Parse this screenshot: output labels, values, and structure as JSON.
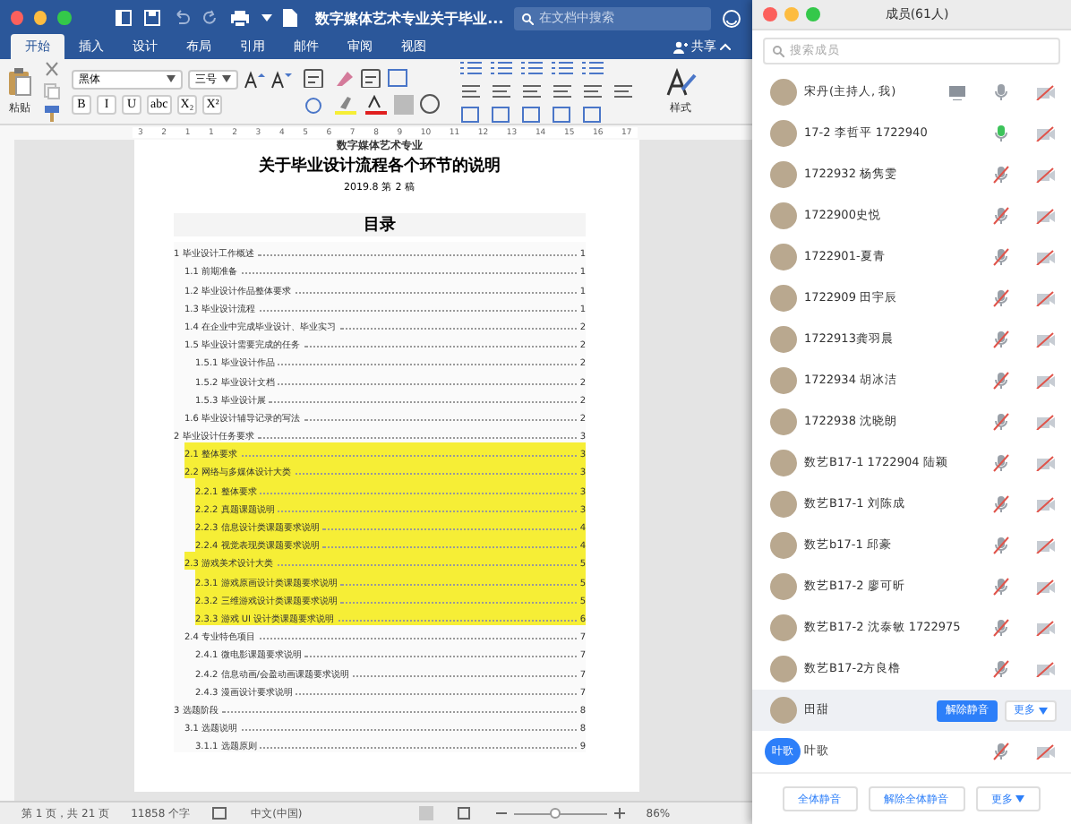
{
  "word": {
    "title": "数字媒体艺术专业关于毕业...",
    "search": {
      "placeholder": "在文档中搜索"
    },
    "tabs": [
      {
        "label": "开始",
        "selected": true
      },
      {
        "label": "插入",
        "selected": false
      },
      {
        "label": "设计",
        "selected": false
      },
      {
        "label": "布局",
        "selected": false
      },
      {
        "label": "引用",
        "selected": false
      },
      {
        "label": "邮件",
        "selected": false
      },
      {
        "label": "审阅",
        "selected": false
      },
      {
        "label": "视图",
        "selected": false
      }
    ],
    "share": "共享",
    "ribbon": {
      "paste": "粘贴",
      "font": "黑体",
      "size": "三号",
      "format_buttons": [
        "B",
        "I",
        "U",
        "abc",
        "X₂",
        "X²"
      ],
      "styles": "样式"
    },
    "ruler": [
      "3",
      "2",
      "1",
      "1",
      "2",
      "3",
      "4",
      "5",
      "6",
      "7",
      "8",
      "9",
      "10",
      "11",
      "12",
      "13",
      "14",
      "15",
      "16",
      "17"
    ],
    "document": {
      "header_cut": "数字媒体艺术专业",
      "title": "关于毕业设计流程各个环节的说明",
      "subtitle": "2019.8  第 2 稿",
      "toc_title": "目录",
      "toc": [
        {
          "text": "1 毕业设计工作概述",
          "page": "1",
          "highlighted": false,
          "children": [
            {
              "text": "1.1 前期准备",
              "page": "1",
              "highlighted": false
            },
            {
              "text": "1.2 毕业设计作品整体要求",
              "page": "1",
              "highlighted": false
            },
            {
              "text": "1.3 毕业设计流程",
              "page": "1",
              "highlighted": false
            },
            {
              "text": "1.4 在企业中完成毕业设计、毕业实习",
              "page": "2",
              "highlighted": false
            },
            {
              "text": "1.5  毕业设计需要完成的任务",
              "page": "2",
              "highlighted": false,
              "children": [
                {
                  "text": "1.5.1 毕业设计作品",
                  "page": "2",
                  "highlighted": false
                },
                {
                  "text": "1.5.2 毕业设计文档",
                  "page": "2",
                  "highlighted": false
                },
                {
                  "text": "1.5.3 毕业设计展",
                  "page": "2",
                  "highlighted": false
                }
              ]
            },
            {
              "text": "1.6  毕业设计辅导记录的写法",
              "page": "2",
              "highlighted": false
            }
          ]
        },
        {
          "text": "2  毕业设计任务要求",
          "page": "3",
          "highlighted": false,
          "children": [
            {
              "text": "2.1 整体要求",
              "page": "3",
              "highlighted": true
            },
            {
              "text": "2.2  网络与多媒体设计大类",
              "page": "3",
              "highlighted": true,
              "children": [
                {
                  "text": "2.2.1 整体要求",
                  "page": "3",
                  "highlighted": true
                },
                {
                  "text": "2.2.2 真题课题说明",
                  "page": "3",
                  "highlighted": true
                },
                {
                  "text": "2.2.3 信息设计类课题要求说明",
                  "page": "4",
                  "highlighted": true
                },
                {
                  "text": "2.2.4 视觉表现类课题要求说明",
                  "page": "4",
                  "highlighted": true
                }
              ]
            },
            {
              "text": "2.3  游戏美术设计大类",
              "page": "5",
              "highlighted": true,
              "children": [
                {
                  "text": "2.3.1  游戏原画设计类课题要求说明",
                  "page": "5",
                  "highlighted": true
                },
                {
                  "text": "2.3.2  三维游戏设计类课题要求说明",
                  "page": "5",
                  "highlighted": true
                },
                {
                  "text": "2.3.3  游戏 UI 设计类课题要求说明",
                  "page": "6",
                  "highlighted": true
                }
              ]
            },
            {
              "text": "2.4  专业特色项目",
              "page": "7",
              "highlighted": false,
              "children": [
                {
                  "text": "2.4.1  微电影课题要求说明",
                  "page": "7",
                  "highlighted": false
                },
                {
                  "text": "2.4.2  信息动画/会盈动画课题要求说明",
                  "page": "7",
                  "highlighted": false
                },
                {
                  "text": "2.4.3  漫画设计要求说明",
                  "page": "7",
                  "highlighted": false
                }
              ]
            }
          ]
        },
        {
          "text": "3 选题阶段",
          "page": "8",
          "highlighted": false,
          "children": [
            {
              "text": "3.1 选题说明",
              "page": "8",
              "highlighted": false,
              "children": [
                {
                  "text": "3.1.1  选题原则",
                  "page": "9",
                  "highlighted": false
                }
              ]
            }
          ]
        }
      ]
    },
    "status_bar": {
      "page": "第 1 页，共 21 页",
      "words": "11858 个字",
      "language": "中文(中国)",
      "zoom_slider": {
        "level": 0.45
      },
      "zoom": "86%"
    }
  },
  "members_panel": {
    "title": "成员(61人)",
    "search": {
      "placeholder": "搜索成员"
    },
    "members": [
      {
        "name": "宋丹(主持人, 我)",
        "muted": false,
        "speaking": false,
        "sharing": true
      },
      {
        "name": "17-2 李哲平 1722940",
        "muted": false,
        "speaking": true,
        "sharing": false
      },
      {
        "name": "1722932 杨隽雯",
        "muted": true,
        "speaking": false,
        "sharing": false
      },
      {
        "name": "1722900史悦",
        "muted": true,
        "speaking": false,
        "sharing": false
      },
      {
        "name": "1722901-夏青",
        "muted": true,
        "speaking": false,
        "sharing": false
      },
      {
        "name": "1722909 田宇辰",
        "muted": true,
        "speaking": false,
        "sharing": false
      },
      {
        "name": "1722913龚羽晨",
        "muted": true,
        "speaking": false,
        "sharing": false
      },
      {
        "name": "1722934 胡冰洁",
        "muted": true,
        "speaking": false,
        "sharing": false
      },
      {
        "name": "1722938 沈晓朗",
        "muted": true,
        "speaking": false,
        "sharing": false
      },
      {
        "name": "数艺B17-1 1722904 陆颖",
        "muted": true,
        "speaking": false,
        "sharing": false
      },
      {
        "name": "数艺B17-1 刘陈成",
        "muted": true,
        "speaking": false,
        "sharing": false
      },
      {
        "name": "数艺b17-1 邱豪",
        "muted": true,
        "speaking": false,
        "sharing": false
      },
      {
        "name": "数艺B17-2  廖可昕",
        "muted": true,
        "speaking": false,
        "sharing": false
      },
      {
        "name": "数艺B17-2 沈泰敏 1722975",
        "muted": true,
        "speaking": false,
        "sharing": false
      },
      {
        "name": "数艺B17-2方良橹",
        "muted": true,
        "speaking": false,
        "sharing": false
      },
      {
        "name": "田甜",
        "actions": [
          "解除静音",
          "更多"
        ]
      },
      {
        "name": "叶歌",
        "muted": true,
        "speaking": false,
        "sharing": false,
        "avatar_text": "叶歌"
      }
    ],
    "footer_buttons": [
      "全体静音",
      "解除全体静音",
      "更多"
    ]
  }
}
